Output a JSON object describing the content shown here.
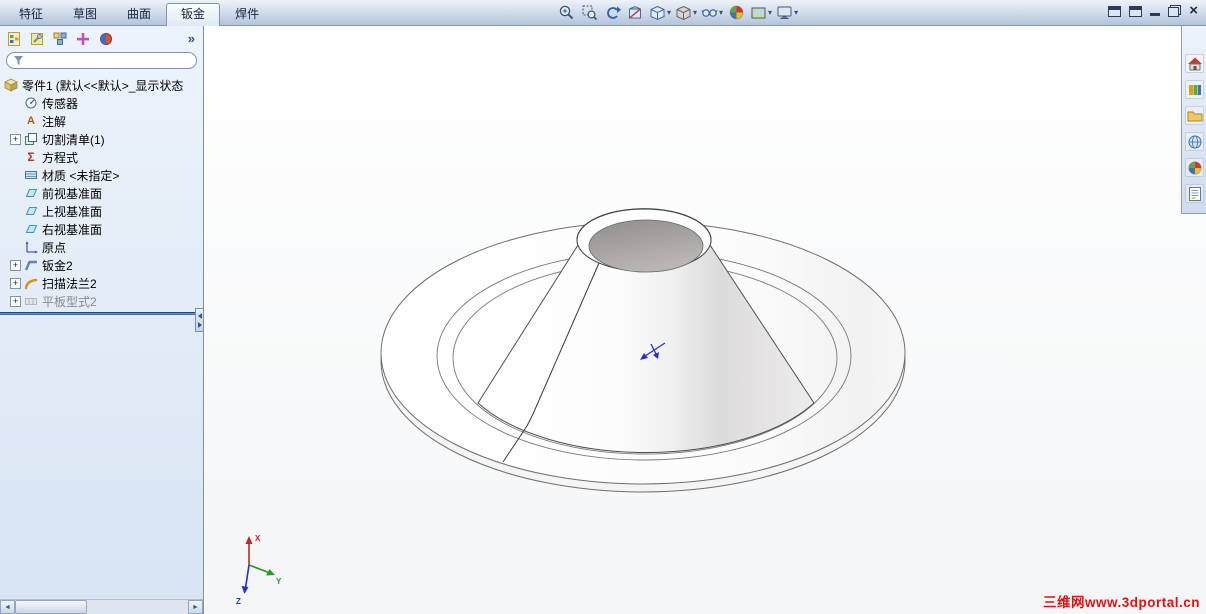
{
  "command_tabs": [
    {
      "label": "特征",
      "active": false
    },
    {
      "label": "草图",
      "active": false
    },
    {
      "label": "曲面",
      "active": false
    },
    {
      "label": "钣金",
      "active": true
    },
    {
      "label": "焊件",
      "active": false
    }
  ],
  "view_toolbar": {
    "icons": [
      {
        "name": "zoom-in-out"
      },
      {
        "name": "zoom-to-area"
      },
      {
        "name": "previous-view"
      },
      {
        "name": "section-view"
      },
      {
        "name": "view-orientation",
        "dropdown": true
      },
      {
        "name": "display-style",
        "dropdown": true
      },
      {
        "name": "hide-show-items",
        "dropdown": true
      },
      {
        "name": "edit-appearance"
      },
      {
        "name": "apply-scene",
        "dropdown": true
      },
      {
        "name": "view-settings",
        "dropdown": true
      }
    ]
  },
  "window_controls": [
    {
      "name": "new-window"
    },
    {
      "name": "cascade-window"
    },
    {
      "name": "minimize"
    },
    {
      "name": "restore"
    },
    {
      "name": "close"
    }
  ],
  "feature_manager": {
    "pane_tabs": [
      {
        "name": "featuremanager-design-tree"
      },
      {
        "name": "propertymanager"
      },
      {
        "name": "configurationmanager"
      },
      {
        "name": "dimxpertmanager"
      },
      {
        "name": "displaymanager"
      }
    ],
    "overflow_glyph": "»",
    "filter": {
      "placeholder": "",
      "value": ""
    },
    "root": {
      "label": "零件1",
      "state": "(默认<<默认>_显示状态"
    },
    "items": [
      {
        "label": "传感器",
        "icon": "sensors-icon",
        "expandable": false
      },
      {
        "label": "注解",
        "icon": "annotations-icon",
        "expandable": false
      },
      {
        "label": "切割清单(1)",
        "icon": "cut-list-icon",
        "expandable": true
      },
      {
        "label": "方程式",
        "icon": "equations-icon",
        "expandable": false
      },
      {
        "label": "材质 <未指定>",
        "icon": "material-icon",
        "expandable": false
      },
      {
        "label": "前视基准面",
        "icon": "plane-icon",
        "expandable": false
      },
      {
        "label": "上视基准面",
        "icon": "plane-icon",
        "expandable": false
      },
      {
        "label": "右视基准面",
        "icon": "plane-icon",
        "expandable": false
      },
      {
        "label": "原点",
        "icon": "origin-icon",
        "expandable": false
      },
      {
        "label": "钣金2",
        "icon": "sheet-metal-icon",
        "expandable": true
      },
      {
        "label": "扫描法兰2",
        "icon": "swept-flange-icon",
        "expandable": true
      },
      {
        "label": "平板型式2",
        "icon": "flat-pattern-icon",
        "expandable": true,
        "suppressed": true
      }
    ]
  },
  "task_pane": {
    "icons": [
      {
        "name": "solidworks-resources"
      },
      {
        "name": "design-library"
      },
      {
        "name": "file-explorer"
      },
      {
        "name": "search-results"
      },
      {
        "name": "appearances-scenes"
      },
      {
        "name": "custom-properties"
      }
    ]
  },
  "viewport": {
    "watermark": "三维网www.3dportal.cn",
    "triad": {
      "x": "X",
      "y": "Y",
      "z": "Z"
    }
  },
  "colors": {
    "rollback_bar": "#2e62a8",
    "watermark": "#e01212",
    "hole_gray": "#a6a3a1",
    "panel_bg": "#dce8f5"
  }
}
